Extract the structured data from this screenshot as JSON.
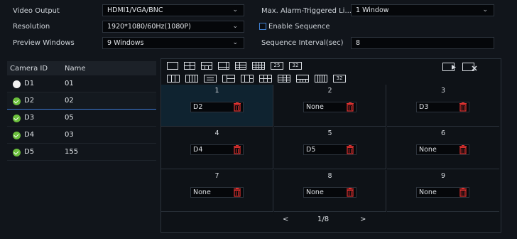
{
  "settings": {
    "video_output_label": "Video Output",
    "video_output_value": "HDMI1/VGA/BNC",
    "resolution_label": "Resolution",
    "resolution_value": "1920*1080/60Hz(1080P)",
    "preview_windows_label": "Preview Windows",
    "preview_windows_value": "9 Windows",
    "max_alarm_label": "Max. Alarm-Triggered Li...",
    "max_alarm_value": "1 Window",
    "enable_sequence_label": "Enable Sequence",
    "enable_sequence_checked": false,
    "sequence_interval_label": "Sequence Interval(sec)",
    "sequence_interval_value": "8"
  },
  "camera_table": {
    "headers": [
      "Camera ID",
      "Name"
    ],
    "rows": [
      {
        "id": "D1",
        "name": "01",
        "status": "white"
      },
      {
        "id": "D2",
        "name": "02",
        "status": "green"
      },
      {
        "id": "D3",
        "name": "05",
        "status": "green"
      },
      {
        "id": "D4",
        "name": "03",
        "status": "green"
      },
      {
        "id": "D5",
        "name": "155",
        "status": "green"
      }
    ]
  },
  "layouts": {
    "text_icons": [
      "25",
      "32",
      "32"
    ]
  },
  "windows": [
    {
      "num": "1",
      "camera": "D2"
    },
    {
      "num": "2",
      "camera": "None"
    },
    {
      "num": "3",
      "camera": "D3"
    },
    {
      "num": "4",
      "camera": "D4"
    },
    {
      "num": "5",
      "camera": "D5"
    },
    {
      "num": "6",
      "camera": "None"
    },
    {
      "num": "7",
      "camera": "None"
    },
    {
      "num": "8",
      "camera": "None"
    },
    {
      "num": "9",
      "camera": "None"
    }
  ],
  "pager": {
    "prev": "<",
    "page": "1/8",
    "next": ">"
  },
  "colors": {
    "accent": "#3d7bd6",
    "online": "#6bbf3c",
    "delete": "#e0312f"
  }
}
